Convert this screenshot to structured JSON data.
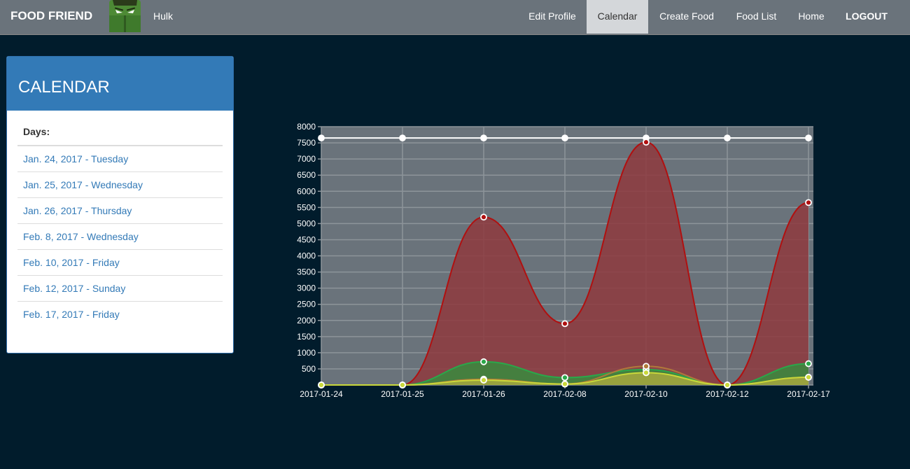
{
  "navbar": {
    "brand": "FOOD FRIEND",
    "username": "Hulk",
    "items": [
      {
        "label": "Edit Profile"
      },
      {
        "label": "Calendar",
        "active": true
      },
      {
        "label": "Create Food"
      },
      {
        "label": "Food List"
      },
      {
        "label": "Home"
      },
      {
        "label": "LOGOUT"
      }
    ]
  },
  "sidebar": {
    "title": "CALENDAR",
    "days_label": "Days:",
    "days": [
      {
        "label": "Jan. 24, 2017 - Tuesday"
      },
      {
        "label": "Jan. 25, 2017 - Wednesday"
      },
      {
        "label": "Jan. 26, 2017 - Thursday"
      },
      {
        "label": "Feb. 8, 2017 - Wednesday"
      },
      {
        "label": "Feb. 10, 2017 - Friday"
      },
      {
        "label": "Feb. 12, 2017 - Sunday"
      },
      {
        "label": "Feb. 17, 2017 - Friday"
      }
    ]
  },
  "colors": {
    "navbar": "#6a737b",
    "background": "#011c2c",
    "panel_heading": "#337ab7",
    "link": "#337ab7",
    "plot_area": "#6a737b"
  },
  "chart_data": {
    "type": "area",
    "x": [
      "2017-01-24",
      "2017-01-25",
      "2017-01-26",
      "2017-02-08",
      "2017-02-10",
      "2017-02-12",
      "2017-02-17"
    ],
    "ylim": [
      0,
      8000
    ],
    "yticks": [
      500,
      1000,
      1500,
      2000,
      2500,
      3000,
      3500,
      4000,
      4500,
      5000,
      5500,
      6000,
      6500,
      7000,
      7500,
      8000
    ],
    "grid": true,
    "series": [
      {
        "color": "#ffffff",
        "fill": "none",
        "values": [
          7650,
          7650,
          7650,
          7650,
          7650,
          7650,
          7650
        ]
      },
      {
        "color": "#b01010",
        "fill": "#8e3a3e",
        "values": [
          0,
          0,
          5200,
          1900,
          7520,
          0,
          5650
        ]
      },
      {
        "color": "#2aa84a",
        "fill": "#3a8a3e",
        "values": [
          0,
          0,
          720,
          230,
          480,
          0,
          660
        ]
      },
      {
        "color": "#b07a3a",
        "fill": "none",
        "values": [
          0,
          0,
          180,
          30,
          580,
          0,
          240
        ]
      },
      {
        "color": "#c9d83a",
        "fill": "#a7a83e",
        "values": [
          0,
          0,
          150,
          30,
          380,
          0,
          240
        ]
      }
    ]
  }
}
